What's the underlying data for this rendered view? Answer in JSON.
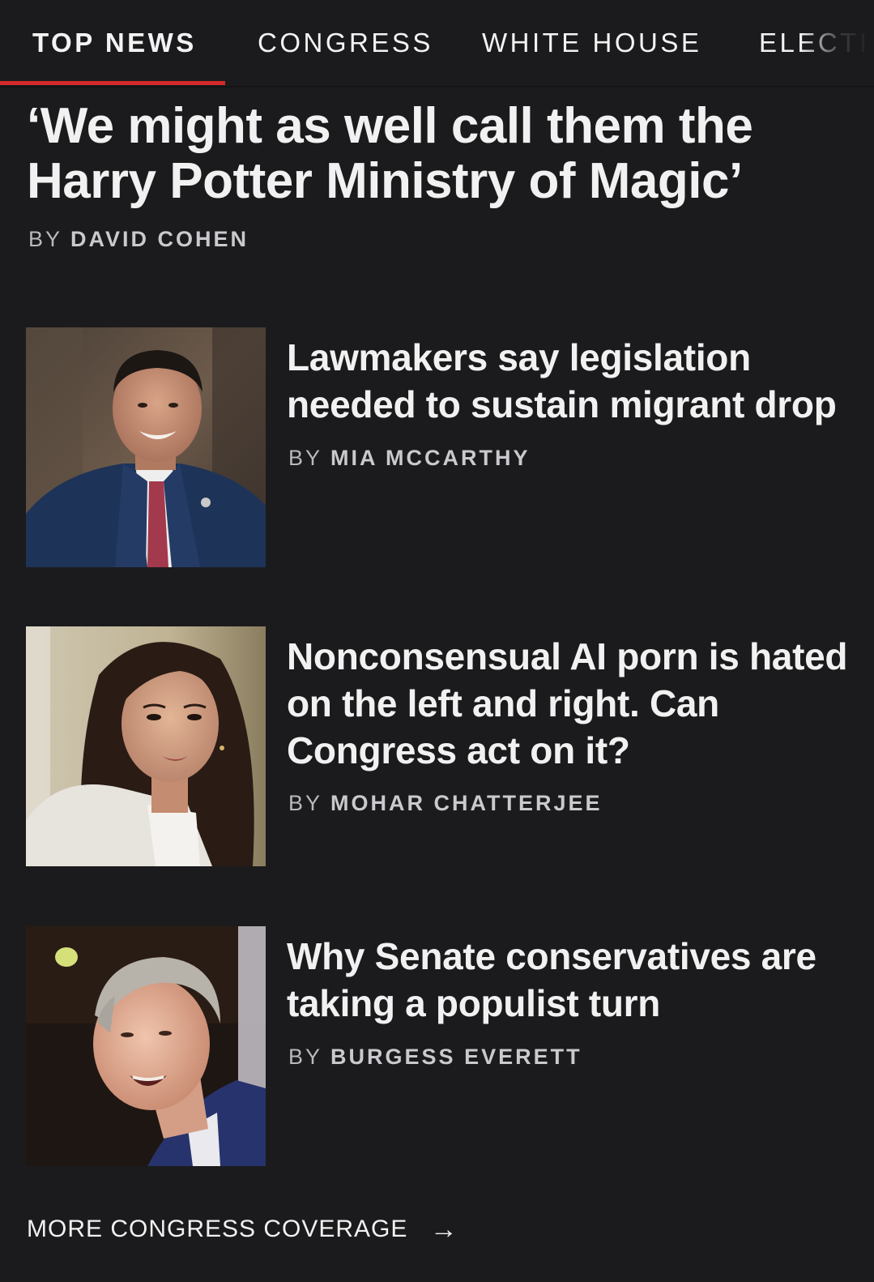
{
  "tabs": [
    {
      "label": "TOP NEWS",
      "active": true
    },
    {
      "label": "CONGRESS",
      "active": false
    },
    {
      "label": "WHITE HOUSE",
      "active": false
    },
    {
      "label": "ELECTI",
      "active": false
    }
  ],
  "accent_color": "#d42a2a",
  "lead": {
    "headline_line1": "‘We might as well call them the",
    "headline_line2": "Harry Potter Ministry of Magic’",
    "byline_prefix": "BY",
    "author": "DAVID COHEN"
  },
  "stories": [
    {
      "headline": "Lawmakers say legislation needed to sustain migrant drop",
      "byline_prefix": "BY",
      "author": "MIA MCCARTHY",
      "image_icon": "man-in-suit-photo"
    },
    {
      "headline": "Nonconsensual AI porn is hated on the left and right. Can Congress act on it?",
      "byline_prefix": "BY",
      "author": "MOHAR CHATTERJEE",
      "image_icon": "woman-portrait-photo"
    },
    {
      "headline": "Why Senate conservatives are taking a populist turn",
      "byline_prefix": "BY",
      "author": "BURGESS EVERETT",
      "image_icon": "senator-speaking-photo"
    }
  ],
  "more_link": {
    "label": "MORE CONGRESS COVERAGE",
    "arrow_icon": "arrow-right-icon"
  }
}
